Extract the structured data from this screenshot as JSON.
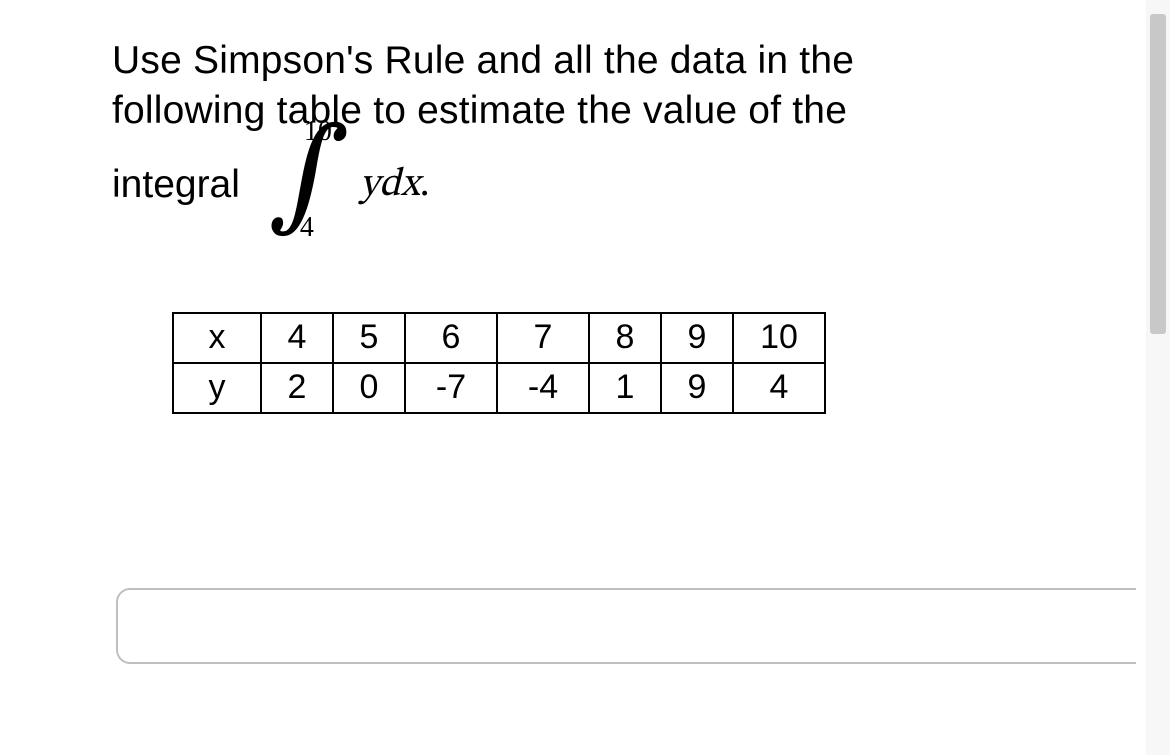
{
  "question": {
    "line1": "Use Simpson's Rule and all the data in the",
    "line2": "following table to estimate the value of the",
    "integral_word": "integral",
    "upper_bound": "10",
    "lower_bound": "4",
    "integrand": "ydx",
    "period": "."
  },
  "table": {
    "row_labels": [
      "x",
      "y"
    ],
    "x": [
      "4",
      "5",
      "6",
      "7",
      "8",
      "9",
      "10"
    ],
    "y": [
      "2",
      "0",
      "-7",
      "-4",
      "1",
      "9",
      "4"
    ]
  },
  "answer": {
    "value": "",
    "placeholder": ""
  }
}
